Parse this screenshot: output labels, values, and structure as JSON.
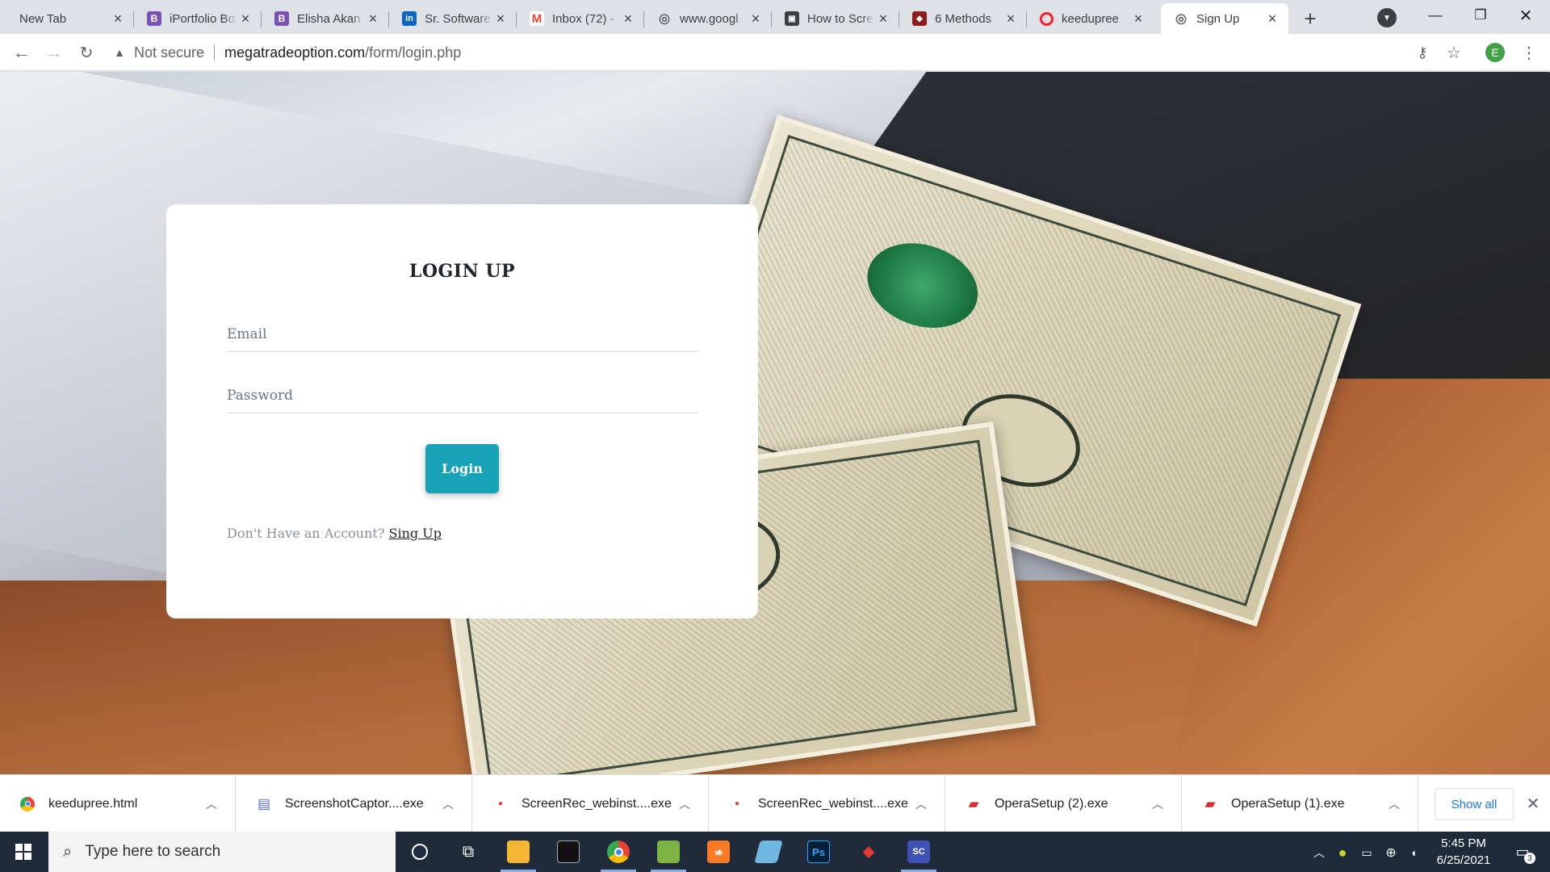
{
  "browser": {
    "tabs": [
      {
        "label": "New Tab",
        "favicon": "none",
        "active": false
      },
      {
        "label": "iPortfolio Bo",
        "favicon": "bootstrap-icon",
        "favicon_color": "#7952b3",
        "favicon_text": "B",
        "active": false
      },
      {
        "label": "Elisha Akan",
        "favicon": "bootstrap-icon",
        "favicon_color": "#7952b3",
        "favicon_text": "B",
        "active": false
      },
      {
        "label": "Sr. Software",
        "favicon": "linkedin-icon",
        "favicon_color": "#0a66c2",
        "favicon_text": "in",
        "active": false
      },
      {
        "label": "Inbox (72) -",
        "favicon": "gmail-icon",
        "favicon_color": "#ea4335",
        "favicon_text": "M",
        "active": false
      },
      {
        "label": "www.googl",
        "favicon": "globe-icon",
        "favicon_color": "#5f6368",
        "favicon_text": "◎",
        "active": false
      },
      {
        "label": "How to Scre",
        "favicon": "page-icon",
        "favicon_color": "#3c4043",
        "favicon_text": "▣",
        "active": false
      },
      {
        "label": "6 Methods",
        "favicon": "site-icon",
        "favicon_color": "#8d1d1d",
        "favicon_text": "◆",
        "active": false
      },
      {
        "label": "keedupree",
        "favicon": "opera-icon",
        "favicon_color": "#ff1b2d",
        "favicon_text": "O",
        "active": false
      },
      {
        "label": "Sign Up",
        "favicon": "globe-icon",
        "favicon_color": "#5f6368",
        "favicon_text": "◎",
        "active": true
      }
    ],
    "tab_close": "×",
    "new_tab": "+",
    "security_label": "Not secure",
    "url_host": "megatradeoption.com",
    "url_path": "/form/login.php",
    "profile_initial": "E",
    "profile_color": "#43a047"
  },
  "page": {
    "title": "LOGIN UP",
    "email_placeholder": "Email",
    "password_placeholder": "Password",
    "login_button": "Login",
    "signup_prompt": "Don't Have an Account?",
    "signup_link": "Sing Up",
    "accent_color": "#17a2b8"
  },
  "downloads": {
    "items": [
      {
        "name": "keedupree.html",
        "icon": "chrome-file-icon",
        "color": "#34a853"
      },
      {
        "name": "ScreenshotCaptor....exe",
        "icon": "installer-icon",
        "color": "#5c6bc0"
      },
      {
        "name": "ScreenRec_webinst....exe",
        "icon": "screenrec-icon",
        "color": "#e53935"
      },
      {
        "name": "ScreenRec_webinst....exe",
        "icon": "screenrec-icon",
        "color": "#e53935"
      },
      {
        "name": "OperaSetup (2).exe",
        "icon": "opera-setup-icon",
        "color": "#d32f2f"
      },
      {
        "name": "OperaSetup (1).exe",
        "icon": "opera-setup-icon",
        "color": "#d32f2f"
      }
    ],
    "show_all": "Show all"
  },
  "taskbar": {
    "search_placeholder": "Type here to search",
    "time": "5:45 PM",
    "date": "6/25/2021",
    "notification_count": "3"
  }
}
